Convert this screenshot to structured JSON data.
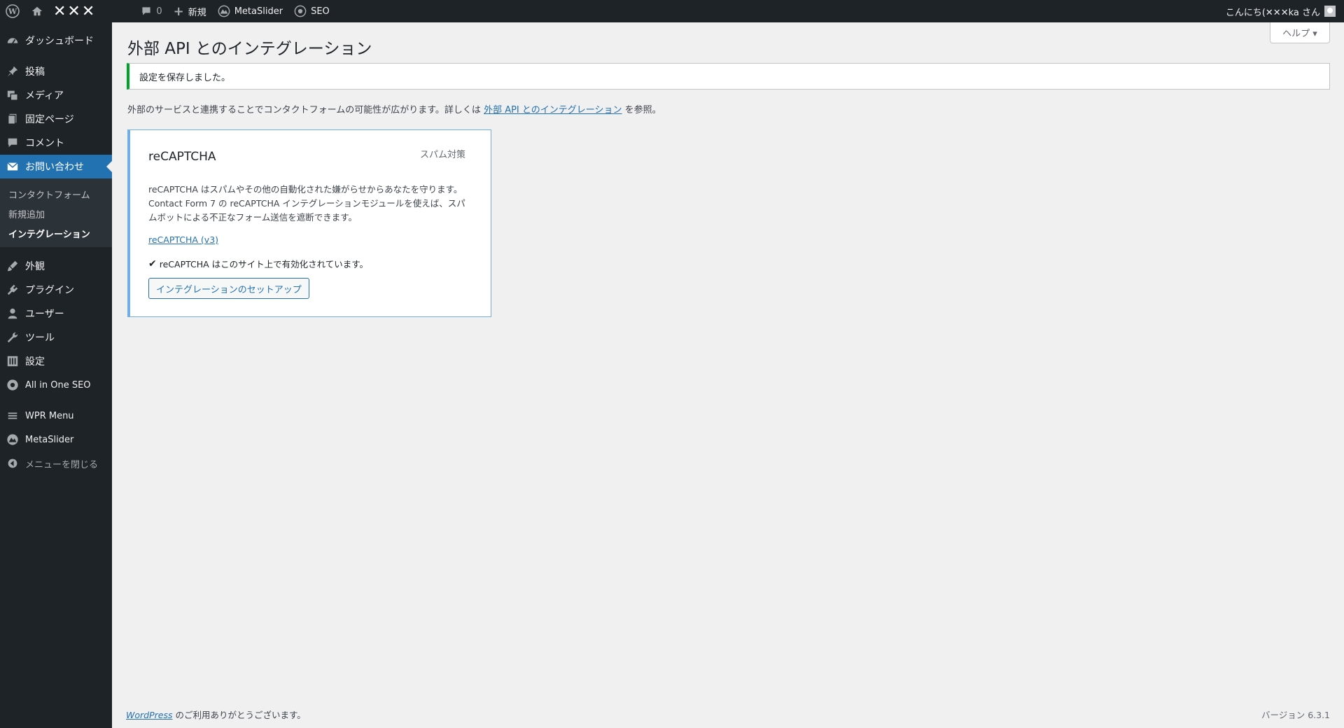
{
  "adminbar": {
    "site_name": "✕✕✕",
    "comments_count": "0",
    "new_label": "新規",
    "metaslider_label": "MetaSlider",
    "seo_label": "SEO",
    "greeting": "こんにち(✕✕✕ka さん"
  },
  "sidebar": {
    "dashboard": "ダッシュボード",
    "posts": "投稿",
    "media": "メディア",
    "pages": "固定ページ",
    "comments": "コメント",
    "contact": "お問い合わせ",
    "sub_items": [
      "コンタクトフォーム",
      "新規追加",
      "インテグレーション"
    ],
    "appearance": "外観",
    "plugins": "プラグイン",
    "users": "ユーザー",
    "tools": "ツール",
    "settings": "設定",
    "aioseo": "All in One SEO",
    "wpr_menu": "WPR Menu",
    "metaslider": "MetaSlider",
    "collapse": "メニューを閉じる"
  },
  "help_tab": "ヘルプ ▾",
  "page_title": "外部 API とのインテグレーション",
  "notice": "設定を保存しました。",
  "intro": {
    "text_before": "外部のサービスと連携することでコンタクトフォームの可能性が広がります。詳しくは",
    "link": "外部 API とのインテグレーション",
    "text_after": "を参照。"
  },
  "card": {
    "title": "reCAPTCHA",
    "category": "スパム対策",
    "description": "reCAPTCHA はスパムやその他の自動化された嫌がらせからあなたを守ります。Contact Form 7 の reCAPTCHA インテグレーションモジュールを使えば、スパムボットによる不正なフォーム送信を遮断できます。",
    "link": "reCAPTCHA (v3)",
    "status": "reCAPTCHA はこのサイト上で有効化されています。",
    "button": "インテグレーションのセットアップ"
  },
  "footer": {
    "wp_link": "WordPress",
    "thanks": " のご利用ありがとうございます。",
    "version": "バージョン 6.3.1"
  },
  "colors": {
    "sidebar_bg": "#1d2327",
    "accent": "#2271b1",
    "notice_success": "#00a32a",
    "card_border": "#72aee6"
  }
}
